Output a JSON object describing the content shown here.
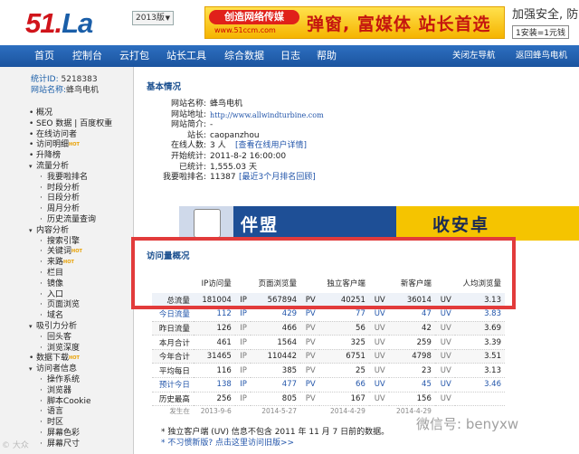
{
  "header": {
    "logo_main": "51.",
    "logo_la": "La",
    "version_select": "2013版",
    "banner1_left": "创造网络传媒",
    "banner1_sub": "www.51ccm.com",
    "banner1_right": "弹窗, 富媒体 站长首选",
    "banner2_line1": "加强安全, 防",
    "banner2_line2": "1安装=1元钱"
  },
  "nav": {
    "items": [
      "首页",
      "控制台",
      "云打包",
      "站长工具",
      "综合数据",
      "日志",
      "帮助"
    ],
    "right_items": [
      "关闭左导航",
      "返回蜂鸟电机"
    ]
  },
  "sidebar": {
    "stat_id_label": "统计ID:",
    "stat_id": "5218383",
    "site_label": "网站名称:",
    "site_name": "蜂鸟电机",
    "menu": [
      {
        "label": "概况",
        "level": 1
      },
      {
        "label": "SEO 数据 | 百度权重",
        "level": 1
      },
      {
        "label": "在线访问者",
        "level": 1
      },
      {
        "label": "访问明细",
        "level": 1,
        "hot": "HOT"
      },
      {
        "label": "升降榜",
        "level": 1
      },
      {
        "label": "流量分析",
        "level": 1,
        "expanded": true
      },
      {
        "label": "我要啦排名",
        "level": 2
      },
      {
        "label": "时段分析",
        "level": 2
      },
      {
        "label": "日段分析",
        "level": 2
      },
      {
        "label": "周月分析",
        "level": 2
      },
      {
        "label": "历史流量查询",
        "level": 2
      },
      {
        "label": "内容分析",
        "level": 1,
        "expanded": true
      },
      {
        "label": "搜索引擎",
        "level": 2
      },
      {
        "label": "关键词",
        "level": 2,
        "hot": "HOT"
      },
      {
        "label": "来路",
        "level": 2,
        "hot": "HOT"
      },
      {
        "label": "栏目",
        "level": 2
      },
      {
        "label": "镜像",
        "level": 2
      },
      {
        "label": "入口",
        "level": 2
      },
      {
        "label": "页面浏览",
        "level": 2
      },
      {
        "label": "域名",
        "level": 2
      },
      {
        "label": "吸引力分析",
        "level": 1,
        "expanded": true
      },
      {
        "label": "回头客",
        "level": 2
      },
      {
        "label": "浏览深度",
        "level": 2
      },
      {
        "label": "数据下载",
        "level": 1,
        "hot": "HOT"
      },
      {
        "label": "访问者信息",
        "level": 1,
        "expanded": true
      },
      {
        "label": "操作系统",
        "level": 2
      },
      {
        "label": "浏览器",
        "level": 2
      },
      {
        "label": "脚本Cookie",
        "level": 2
      },
      {
        "label": "语言",
        "level": 2
      },
      {
        "label": "时区",
        "level": 2
      },
      {
        "label": "屏幕色彩",
        "level": 2
      },
      {
        "label": "屏幕尺寸",
        "level": 2
      }
    ]
  },
  "basic": {
    "title": "基本情况",
    "rows": [
      {
        "label": "网站名称:",
        "value": "蜂鸟电机"
      },
      {
        "label": "网站地址:",
        "value": "http://www.allwindturbine.com",
        "link": true
      },
      {
        "label": "网站简介:",
        "value": "-"
      },
      {
        "label": "站长:",
        "value": "caopanzhou"
      },
      {
        "label": "在线人数:",
        "value": "3 人",
        "sub": "[查看在线用户详情]"
      },
      {
        "label": "开始统计:",
        "value": "2011-8-2 16:00:00"
      },
      {
        "label": "已统计:",
        "value": "1,555.03 天"
      },
      {
        "label": "我要啦排名:",
        "value": "11387",
        "sub": "[最近3个月排名回顾]"
      }
    ]
  },
  "ad_banner": {
    "left_text": "伴盟",
    "right_text": "收安卓"
  },
  "traffic": {
    "title": "访问量概况",
    "headers": [
      "",
      "IP访问量",
      "",
      "页面浏览量",
      "",
      "独立客户端",
      "",
      "新客户端",
      "",
      "人均浏览量"
    ],
    "rows": [
      {
        "label": "总流量",
        "ip": "181004",
        "pv": "567894",
        "uv": "40251",
        "nv": "36014",
        "avg": "3.13",
        "cls": "total"
      },
      {
        "label": "今日流量",
        "ip": "112",
        "pv": "429",
        "uv": "77",
        "nv": "47",
        "avg": "3.83",
        "cls": "pred"
      },
      {
        "label": "昨日流量",
        "ip": "126",
        "pv": "466",
        "uv": "56",
        "nv": "42",
        "avg": "3.69",
        "cls": "alt"
      },
      {
        "label": "本月合计",
        "ip": "461",
        "pv": "1564",
        "uv": "325",
        "nv": "259",
        "avg": "3.39",
        "cls": ""
      },
      {
        "label": "今年合计",
        "ip": "31465",
        "pv": "110442",
        "uv": "6751",
        "nv": "4798",
        "avg": "3.51",
        "cls": "alt"
      },
      {
        "label": "平均每日",
        "ip": "116",
        "pv": "385",
        "uv": "25",
        "nv": "23",
        "avg": "3.13",
        "cls": ""
      },
      {
        "label": "预计今日",
        "ip": "138",
        "pv": "477",
        "uv": "66",
        "nv": "45",
        "avg": "3.46",
        "cls": "pred"
      },
      {
        "label": "历史最高",
        "ip": "256",
        "pv": "805",
        "uv": "167",
        "nv": "156",
        "avg": "",
        "cls": ""
      }
    ],
    "units": {
      "ip": "IP",
      "pv": "PV",
      "uv": "UV"
    },
    "date_row": {
      "label": "发生在",
      "ip": "2013-9-6",
      "pv": "2014-5-27",
      "uv": "2014-4-29",
      "nv": "2014-4-29"
    },
    "note1": "* 独立客户端 (UV) 信息不包含 2011 年 11 月 7 日前的数据。",
    "note2": "* 不习惯新版? 点击这里访问旧版>>"
  },
  "watermark": {
    "wechat": "微信号: benyxw",
    "left": "© 大众"
  }
}
